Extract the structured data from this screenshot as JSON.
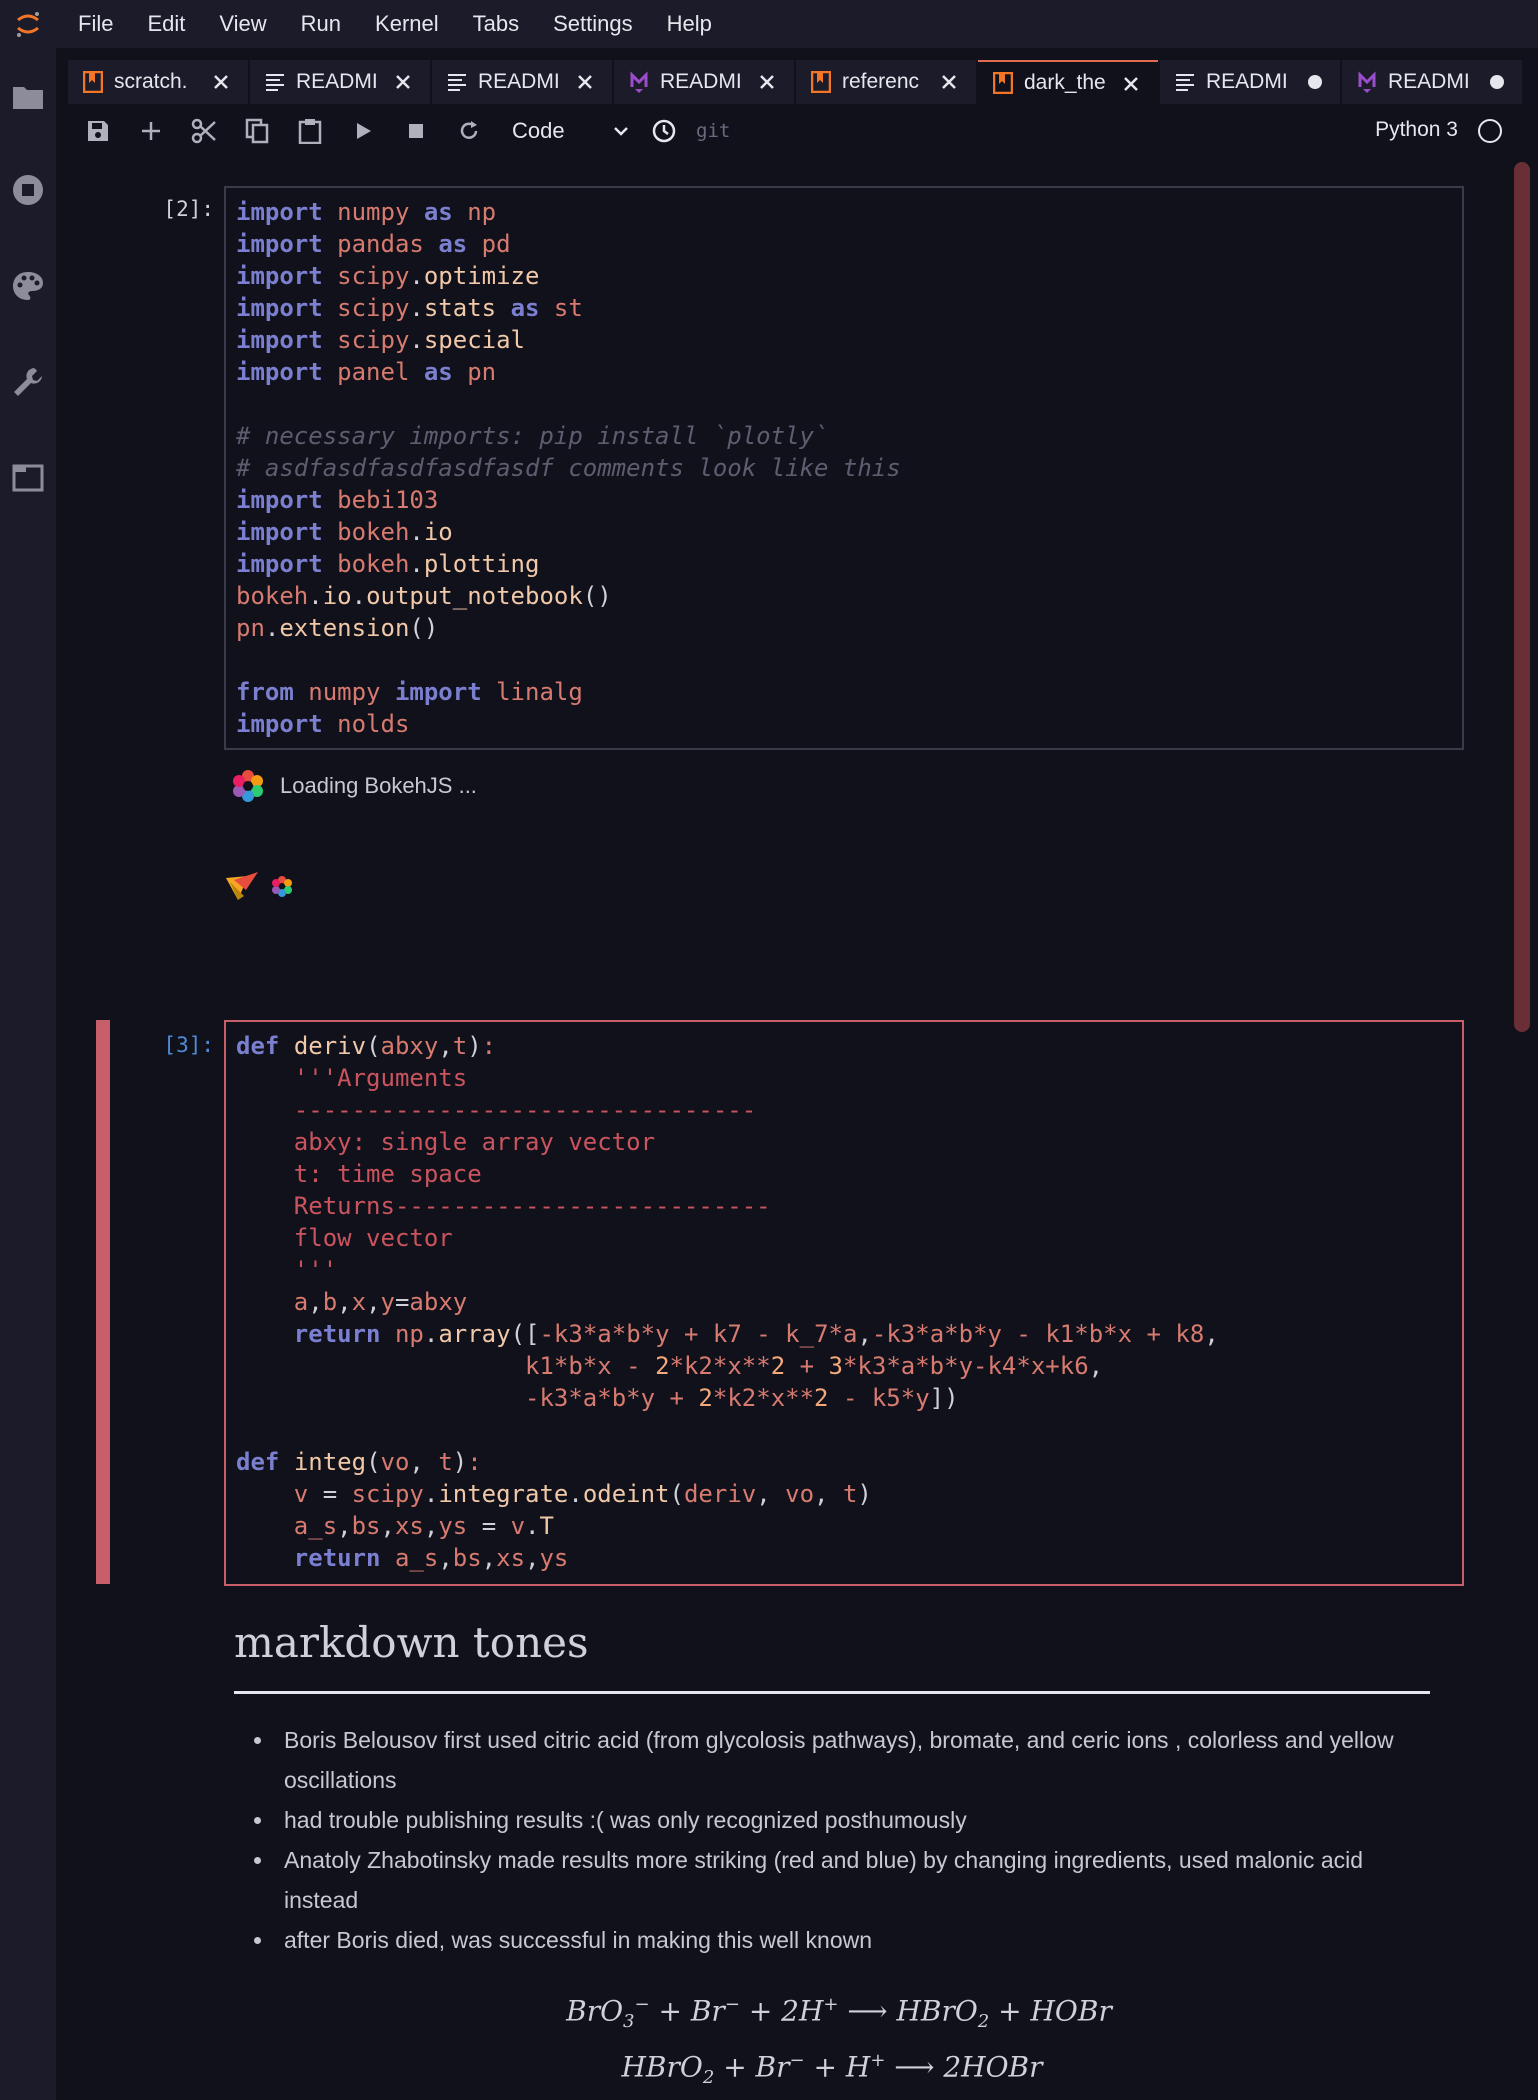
{
  "menubar": {
    "items": [
      "File",
      "Edit",
      "View",
      "Run",
      "Kernel",
      "Tabs",
      "Settings",
      "Help"
    ]
  },
  "tabs": [
    {
      "label": "scratch.",
      "icon": "notebook-icon",
      "state": "close"
    },
    {
      "label": "READMI",
      "icon": "text-file-icon",
      "state": "close"
    },
    {
      "label": "READMI",
      "icon": "text-file-icon",
      "state": "close"
    },
    {
      "label": "READMI",
      "icon": "markdown-icon",
      "state": "close"
    },
    {
      "label": "referenc",
      "icon": "notebook-icon",
      "state": "close"
    },
    {
      "label": "dark_the",
      "icon": "notebook-icon",
      "state": "close",
      "active": true
    },
    {
      "label": "READMI",
      "icon": "text-file-icon",
      "state": "dirty"
    },
    {
      "label": "READMI",
      "icon": "markdown-icon",
      "state": "dirty"
    }
  ],
  "toolbar": {
    "cell_type": "Code",
    "git_label": "git",
    "kernel_name": "Python 3"
  },
  "cells": {
    "cell1": {
      "prompt": "[2]:",
      "lines": [
        "import numpy as np",
        "import pandas as pd",
        "import scipy.optimize",
        "import scipy.stats as st",
        "import scipy.special",
        "import panel as pn",
        "",
        "# necessary imports: pip install `plotly`",
        "# asdfasdfasdfasdfasdf comments look like this",
        "import bebi103",
        "import bokeh.io",
        "import bokeh.plotting",
        "bokeh.io.output_notebook()",
        "pn.extension()",
        "",
        "from numpy import linalg",
        "import nolds"
      ]
    },
    "output": {
      "loading_text": "Loading BokehJS ..."
    },
    "cell2": {
      "prompt": "[3]:",
      "lines": [
        "def deriv(abxy,t):",
        "    '''Arguments",
        "    --------------------------------",
        "    abxy: single array vector",
        "    t: time space",
        "    Returns--------------------------",
        "    flow vector",
        "    '''",
        "    a,b,x,y=abxy",
        "    return np.array([-k3*a*b*y + k7 - k_7*a,-k3*a*b*y - k1*b*x + k8,",
        "                    k1*b*x - 2*k2*x**2 + 3*k3*a*b*y-k4*x+k6,",
        "                    -k3*a*b*y + 2*k2*x**2 - k5*y])",
        "",
        "def integ(vo, t):",
        "    v = scipy.integrate.odeint(deriv, vo, t)",
        "    a_s,bs,xs,ys = v.T",
        "    return a_s,bs,xs,ys"
      ]
    }
  },
  "markdown": {
    "heading": "markdown tones",
    "bullets": [
      "Boris Belousov first used citric acid (from glycolosis pathways), bromate, and ceric ions , colorless and yellow oscillations",
      "had trouble publishing results :( was only recognized posthumously",
      "Anatoly Zhabotinsky made results more striking (red and blue) by changing ingredients, used malonic acid instead",
      "after Boris died, was successful in making this well known"
    ],
    "equations": [
      "BrO3⁻ + Br⁻ + 2H⁺ ⟶ HBrO2 + HOBr",
      "HBrO2 + Br⁻ + H⁺ ⟶ 2HOBr"
    ]
  }
}
